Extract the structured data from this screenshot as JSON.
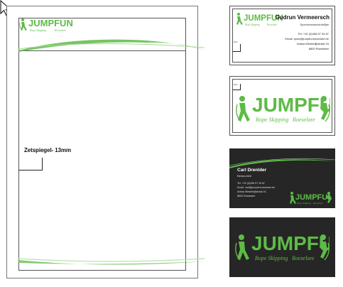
{
  "brand": {
    "name": "JUMPFUN",
    "tagline_left": "Rope Skipping",
    "tagline_right": "Roeselare",
    "green": "#5dbb46",
    "dark": "#262626"
  },
  "letterhead": {
    "margin_label": "Zetspiegel- 13mm"
  },
  "card_front_light": {
    "name": "Gudrun Vermeersch",
    "role": "Sportverantwoordelijke",
    "phone": "Tel: +32 (0)456 57 34 87",
    "email": "Email: sport@jumpfunroeselare.be",
    "address": "Antwa Westerlijkstraat 16",
    "city": "8800 Roeselare",
    "margin_note": "3mm"
  },
  "card_back_light": {
    "margin_note": "3mm"
  },
  "card_front_dark": {
    "name": "Carl Drenlder",
    "role": "Bestuurslid",
    "phone": "Tel: +32 (0)456 57 34 87",
    "email": "Email: carl@jumpfunroeselare.be",
    "address": "Antwa Westerlijkstraat 16",
    "city": "8800 Roeselare"
  }
}
